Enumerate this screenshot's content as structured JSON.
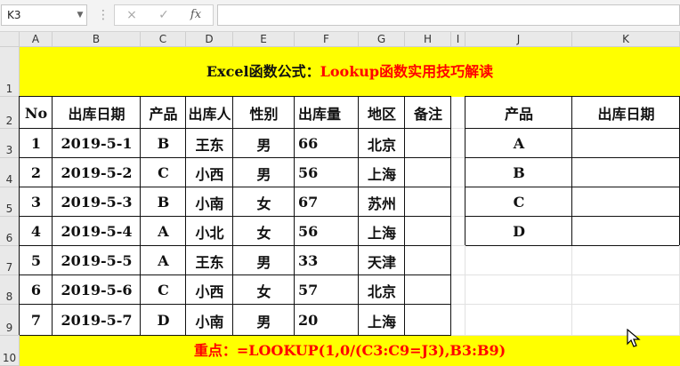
{
  "formula_bar": {
    "name_box": "K3",
    "cancel_icon": "×",
    "enter_icon": "✓",
    "fx_label": "fx",
    "formula": ""
  },
  "columns": [
    "A",
    "B",
    "C",
    "D",
    "E",
    "F",
    "G",
    "H",
    "I",
    "J",
    "K"
  ],
  "rows": [
    "1",
    "2",
    "3",
    "4",
    "5",
    "6",
    "7",
    "8",
    "9",
    "10"
  ],
  "title": {
    "prefix": "Excel函数公式：",
    "highlight": "Lookup函数实用技巧解读"
  },
  "table": {
    "headers": [
      "No",
      "出库日期",
      "产品",
      "出库人",
      "性别",
      "出库量",
      "地区",
      "备注"
    ],
    "rows": [
      [
        "1",
        "2019-5-1",
        "B",
        "王东",
        "男",
        "66",
        "北京",
        ""
      ],
      [
        "2",
        "2019-5-2",
        "C",
        "小西",
        "男",
        "56",
        "上海",
        ""
      ],
      [
        "3",
        "2019-5-3",
        "B",
        "小南",
        "女",
        "67",
        "苏州",
        ""
      ],
      [
        "4",
        "2019-5-4",
        "A",
        "小北",
        "女",
        "56",
        "上海",
        ""
      ],
      [
        "5",
        "2019-5-5",
        "A",
        "王东",
        "男",
        "33",
        "天津",
        ""
      ],
      [
        "6",
        "2019-5-6",
        "C",
        "小西",
        "女",
        "57",
        "北京",
        ""
      ],
      [
        "7",
        "2019-5-7",
        "D",
        "小南",
        "男",
        "20",
        "上海",
        ""
      ]
    ]
  },
  "lookup_table": {
    "headers": [
      "产品",
      "出库日期"
    ],
    "rows": [
      [
        "A",
        ""
      ],
      [
        "B",
        ""
      ],
      [
        "C",
        ""
      ],
      [
        "D",
        ""
      ]
    ]
  },
  "footer": {
    "label": "重点：",
    "formula": "=LOOKUP(1,0/(C3:C9=J3),B3:B9)"
  },
  "colors": {
    "banner": "#ffff00",
    "accent_red": "#ff0000"
  }
}
